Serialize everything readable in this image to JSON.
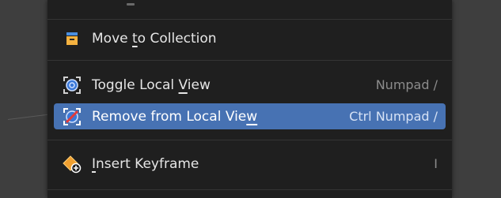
{
  "menu": {
    "items": [
      {
        "pre": "Move ",
        "key": "t",
        "post": "o Collection",
        "shortcut": ""
      },
      {
        "pre": "Toggle Local ",
        "key": "V",
        "post": "iew",
        "shortcut": "Numpad /"
      },
      {
        "pre": "Remove from Local Vie",
        "key": "w",
        "post": "",
        "shortcut": "Ctrl Numpad /"
      },
      {
        "pre": "",
        "key": "I",
        "post": "nsert Keyframe",
        "shortcut": "I"
      }
    ]
  },
  "colors": {
    "menu_bg": "#1f1f1f",
    "highlight": "#4772b3",
    "text": "#e6e6e6",
    "shortcut": "#8c8c8c"
  },
  "icons": {
    "move_to_collection": "collection-icon",
    "toggle_local_view": "local-view-icon",
    "remove_from_local_view": "remove-local-view-icon",
    "insert_keyframe": "keyframe-add-icon"
  }
}
